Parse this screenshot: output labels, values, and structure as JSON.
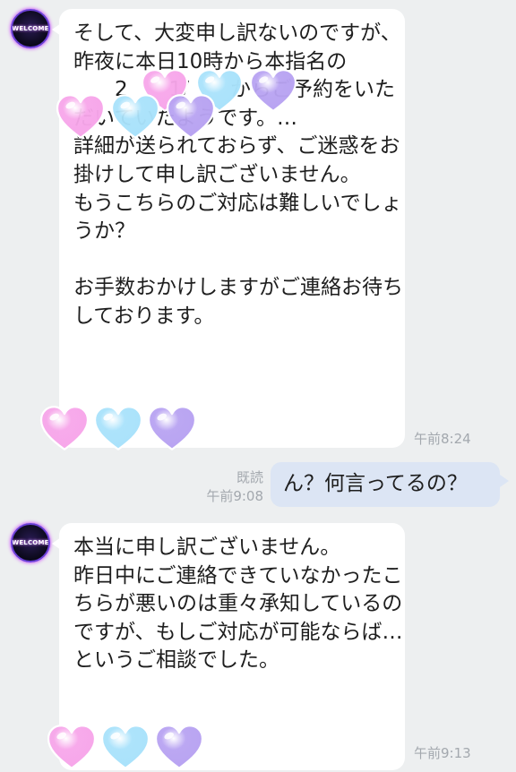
{
  "messages": [
    {
      "sender": "other",
      "avatar_text": "WELCOME",
      "text": "そして、大変申し訳ないのですが、昨夜に本日10時から本指名の\n　　2　　1/　　からご予約をいただいていたようです。…\n詳細が送られておらず、ご迷惑をお掛けして申し訳ございません。\nもうこちらのご対応は難しいでしょうか？\n\nお手数おかけしますがご連絡お待ちしております。",
      "time": "午前8:24"
    },
    {
      "sender": "me",
      "read_label": "既読",
      "text": "ん？何言ってるの？",
      "time": "午前9:08"
    },
    {
      "sender": "other",
      "avatar_text": "WELCOME",
      "text": "本当に申し訳ございません。\n昨日中にご連絡できていなかったこちらが悪いのは重々承知しているのですが、もしご対応が可能ならば…というご相談でした。",
      "time": "午前9:13"
    }
  ],
  "sticker_colors": {
    "pink": "#f7a6ea",
    "blue": "#a9e2fb",
    "purple": "#b8a3f2"
  },
  "icons": {
    "heart": "heart-icon"
  }
}
